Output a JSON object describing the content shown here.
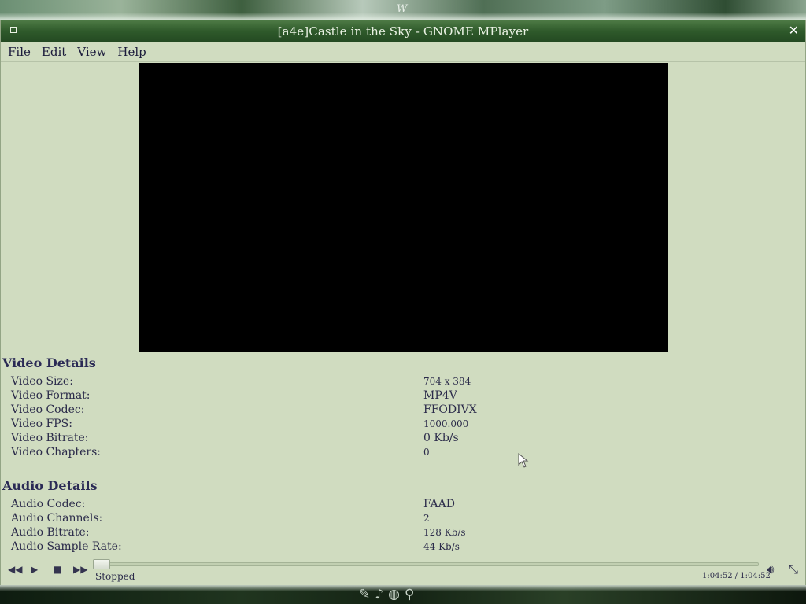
{
  "desktop": {
    "top_glyph": "W",
    "dock_icons": [
      "brush-icon",
      "music-note-icon",
      "globe-icon",
      "search-icon"
    ]
  },
  "window": {
    "title": "[a4e]Castle in the Sky - GNOME MPlayer"
  },
  "menu": {
    "file": {
      "accel": "F",
      "rest": "ile"
    },
    "edit": {
      "accel": "E",
      "rest": "dit"
    },
    "view": {
      "accel": "V",
      "rest": "iew"
    },
    "help": {
      "accel": "H",
      "rest": "elp"
    }
  },
  "video_details": {
    "title": "Video Details",
    "rows": [
      {
        "label": "Video Size:",
        "value": "704 x 384"
      },
      {
        "label": "Video Format:",
        "value": "MP4V"
      },
      {
        "label": "Video Codec:",
        "value": "FFODIVX"
      },
      {
        "label": "Video FPS:",
        "value": "1000.000"
      },
      {
        "label": "Video Bitrate:",
        "value": "0 Kb/s"
      },
      {
        "label": "Video Chapters:",
        "value": "0"
      }
    ]
  },
  "audio_details": {
    "title": "Audio Details",
    "rows": [
      {
        "label": "Audio Codec:",
        "value": "FAAD"
      },
      {
        "label": "Audio Channels:",
        "value": "2"
      },
      {
        "label": "Audio Bitrate:",
        "value": "128 Kb/s"
      },
      {
        "label": "Audio Sample Rate:",
        "value": "44 Kb/s"
      }
    ]
  },
  "playback": {
    "status": "Stopped",
    "time": "1:04:52  /  1:04:52",
    "progress_fraction": 0.0,
    "buttons": [
      "rewind-icon",
      "play-icon",
      "stop-icon",
      "fast-forward-icon"
    ]
  },
  "colors": {
    "window_bg": "#d0dcc0",
    "titlebar": "#2f5a2b",
    "text": "#2b2b4a"
  }
}
